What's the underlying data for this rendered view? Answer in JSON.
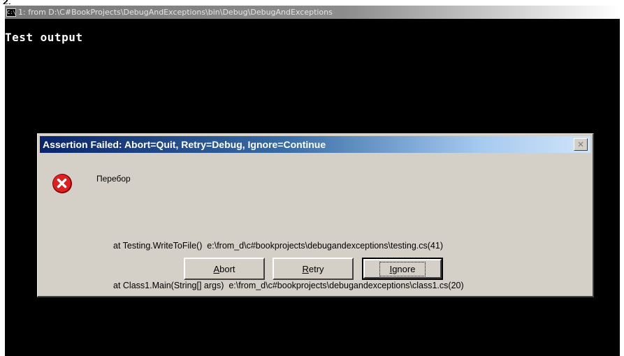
{
  "page_marker": "2.",
  "console": {
    "title": "1: from D:\\C#BookProjects\\DebugAndExceptions\\bin\\Debug\\DebugAndExceptions",
    "output": "Test output"
  },
  "dialog": {
    "title": "Assertion Failed: Abort=Quit, Retry=Debug, Ignore=Continue",
    "close_glyph": "✕",
    "message": "Перебор",
    "stack_lines": [
      "at Testing.WriteToFile()  e:\\from_d\\c#bookprojects\\debugandexceptions\\testing.cs(41)",
      "at Class1.Main(String[] args)  e:\\from_d\\c#bookprojects\\debugandexceptions\\class1.cs(20)"
    ],
    "buttons": {
      "abort": {
        "first": "A",
        "rest": "bort"
      },
      "retry": {
        "first": "R",
        "rest": "etry"
      },
      "ignore": {
        "first": "I",
        "rest": "gnore"
      }
    }
  },
  "icons": {
    "console": "console-window-icon",
    "error": "error-icon",
    "close": "close-icon"
  },
  "colors": {
    "console_bg": "#000000",
    "dialog_bg": "#d4d0c8",
    "title_start": "#0a246a",
    "title_end": "#a6caf0",
    "error_red": "#e02020"
  }
}
